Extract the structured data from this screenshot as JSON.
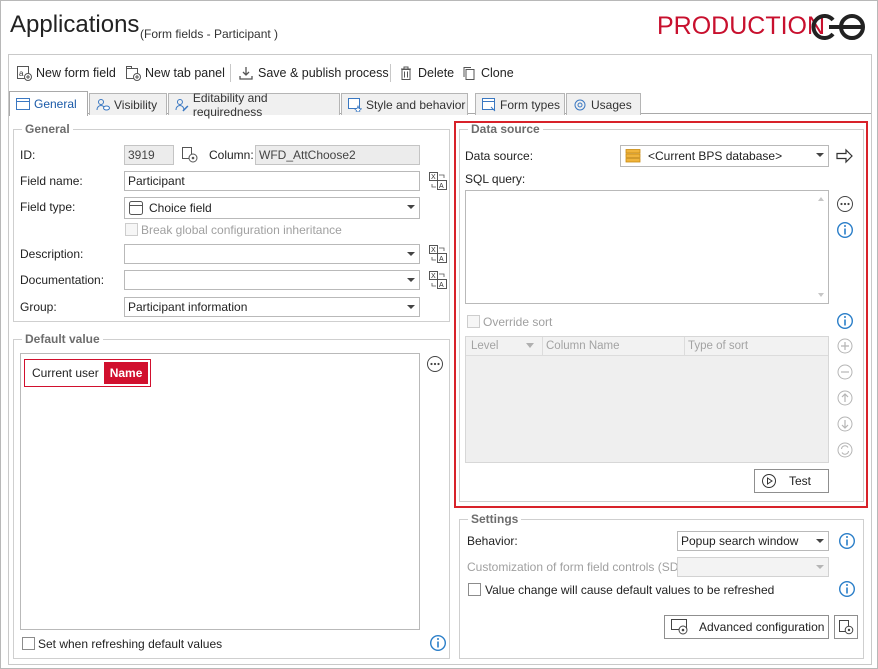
{
  "header": {
    "title": "Applications",
    "subtitle": "(Form fields - Participant )",
    "environment": "PRODUCTION"
  },
  "toolbar": {
    "new_form_field": "New form field",
    "new_tab_panel": "New tab panel",
    "save_publish": "Save & publish process",
    "delete": "Delete",
    "clone": "Clone"
  },
  "tabs": [
    {
      "label": "General",
      "active": true
    },
    {
      "label": "Visibility"
    },
    {
      "label": "Editability and requiredness"
    },
    {
      "label": "Style and behavior"
    },
    {
      "label": "Form types"
    },
    {
      "label": "Usages"
    }
  ],
  "general": {
    "title": "General",
    "id_label": "ID:",
    "id_value": "3919",
    "column_label": "Column:",
    "column_value": "WFD_AttChoose2",
    "field_name_label": "Field name:",
    "field_name_value": "Participant",
    "field_type_label": "Field type:",
    "field_type_value": "Choice field",
    "break_inheritance": "Break global configuration inheritance",
    "description_label": "Description:",
    "description_value": "",
    "documentation_label": "Documentation:",
    "documentation_value": "",
    "group_label": "Group:",
    "group_value": "Participant information"
  },
  "default_value": {
    "title": "Default value",
    "token_label": "Current user",
    "token_value": "Name",
    "set_when_refreshing": "Set when refreshing default values"
  },
  "data_source": {
    "title": "Data source",
    "source_label": "Data source:",
    "source_value": "<Current BPS database>",
    "sql_label": "SQL query:",
    "sql_value": "",
    "override_sort": "Override sort",
    "columns": [
      "Level",
      "Column Name",
      "Type of sort"
    ],
    "test_button": "Test"
  },
  "settings": {
    "title": "Settings",
    "behavior_label": "Behavior:",
    "behavior_value": "Popup search window",
    "customization_label": "Customization of form field controls (SDK):",
    "customization_value": "",
    "value_change": "Value change will cause default values to be refreshed",
    "advanced_config": "Advanced configuration"
  },
  "colors": {
    "accent_red": "#d8222a",
    "tab_active_text": "#1a5aa8",
    "info_blue": "#2a7ec8"
  }
}
